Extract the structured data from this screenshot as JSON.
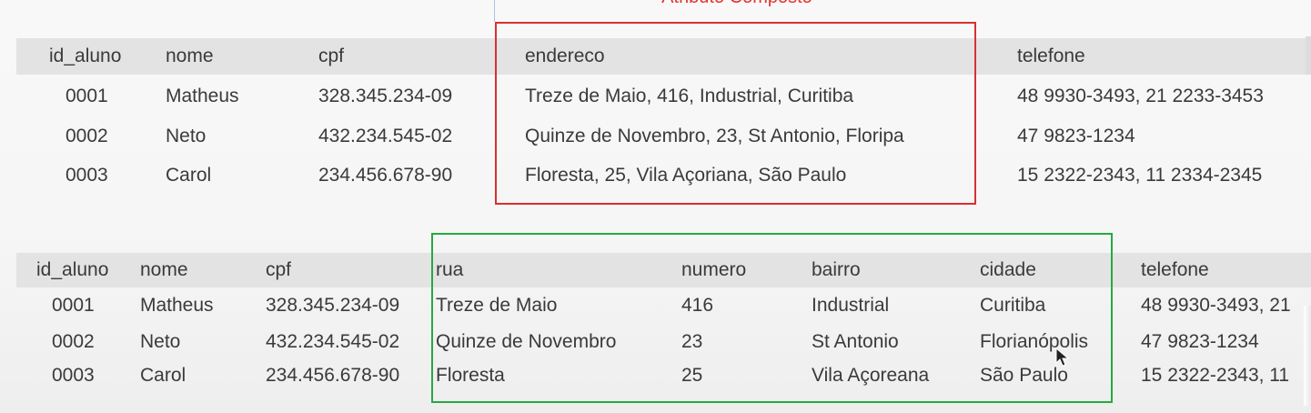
{
  "caption": "Atributo Composto",
  "table1": {
    "headers": [
      "id_aluno",
      "nome",
      "cpf",
      "endereco",
      "telefone"
    ],
    "rows": [
      [
        "0001",
        "Matheus",
        "328.345.234-09",
        "Treze de Maio, 416, Industrial, Curitiba",
        "48 9930-3493, 21 2233-3453"
      ],
      [
        "0002",
        "Neto",
        "432.234.545-02",
        "Quinze de Novembro, 23, St Antonio, Floripa",
        "47 9823-1234"
      ],
      [
        "0003",
        "Carol",
        "234.456.678-90",
        "Floresta, 25, Vila Açoriana, São Paulo",
        "15 2322-2343, 11 2334-2345"
      ]
    ]
  },
  "table2": {
    "headers": [
      "id_aluno",
      "nome",
      "cpf",
      "rua",
      "numero",
      "bairro",
      "cidade",
      "telefone"
    ],
    "rows": [
      [
        "0001",
        "Matheus",
        "328.345.234-09",
        "Treze de Maio",
        "416",
        "Industrial",
        "Curitiba",
        "48 9930-3493, 21"
      ],
      [
        "0002",
        "Neto",
        "432.234.545-02",
        "Quinze de Novembro",
        "23",
        "St Antonio",
        "Florianópolis",
        "47 9823-1234"
      ],
      [
        "0003",
        "Carol",
        "234.456.678-90",
        "Floresta",
        "25",
        "Vila Açoreana",
        "São Paulo",
        "15 2322-2343, 11"
      ]
    ]
  },
  "colors": {
    "highlight_composite": "#d93030",
    "highlight_split": "#26a83f",
    "caption": "#e2342b"
  }
}
